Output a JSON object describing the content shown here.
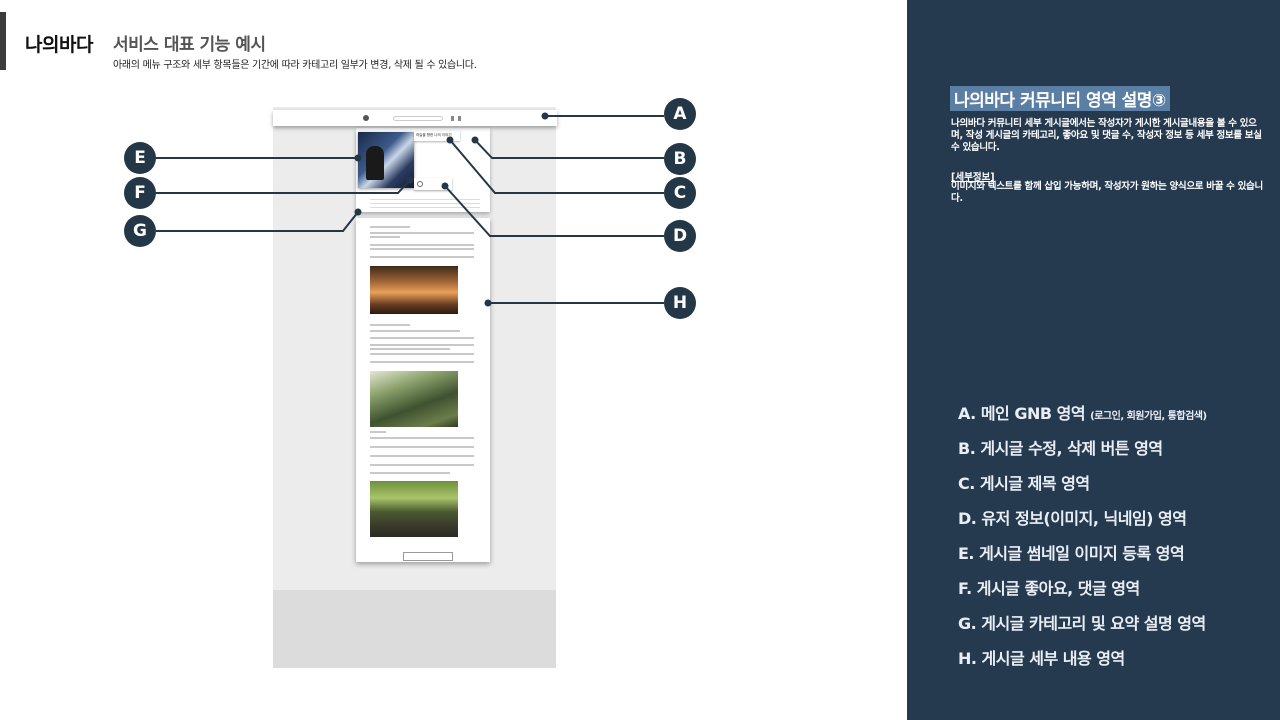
{
  "header": {
    "brand": "나의바다",
    "title": "서비스 대표 기능 예시",
    "subtitle": "아래의 메뉴 구조와 세부 항목들은 기간에 따라 카테고리 일부가 변경, 삭제 될 수 있습니다."
  },
  "mockup": {
    "post_title": "하늘을 향한 나의 이야기",
    "more_button": "더보기"
  },
  "callouts": {
    "a": "A",
    "b": "B",
    "c": "C",
    "d": "D",
    "e": "E",
    "f": "F",
    "g": "G",
    "h": "H"
  },
  "panel": {
    "title": "나의바다 커뮤니티 영역 설명③",
    "description": "나의바다 커뮤니티 세부 게시글에서는 작성자가 게시한 게시글내용을 볼 수 있으며, 작성 게시글의 카테고리, 좋아요 및 댓글 수, 작성자 정보 등 세부 정보를 보실 수 있습니다.",
    "subheading": "[세부정보]",
    "subdescription": "이미지와 텍스트를 함께 삽입 가능하며, 작성자가 원하는 양식으로 바꿀 수 있습니다.",
    "legend": [
      {
        "text": "A. 메인 GNB 영역",
        "note": "(로그인, 회원가입, 통합검색)"
      },
      {
        "text": "B. 게시글 수정, 삭제 버튼 영역",
        "note": ""
      },
      {
        "text": "C. 게시글 제목 영역",
        "note": ""
      },
      {
        "text": "D. 유저 정보(이미지, 닉네임) 영역",
        "note": ""
      },
      {
        "text": "E. 게시글 썸네일 이미지 등록 영역",
        "note": ""
      },
      {
        "text": "F. 게시글 좋아요, 댓글 영역",
        "note": ""
      },
      {
        "text": "G. 게시글 카테고리 및 요약 설명 영역",
        "note": ""
      },
      {
        "text": "H. 게시글 세부 내용 영역",
        "note": ""
      }
    ]
  },
  "colors": {
    "panel_bg": "#263a4f",
    "callout_bg": "#243747",
    "title_highlight": "#5b7ea4"
  }
}
